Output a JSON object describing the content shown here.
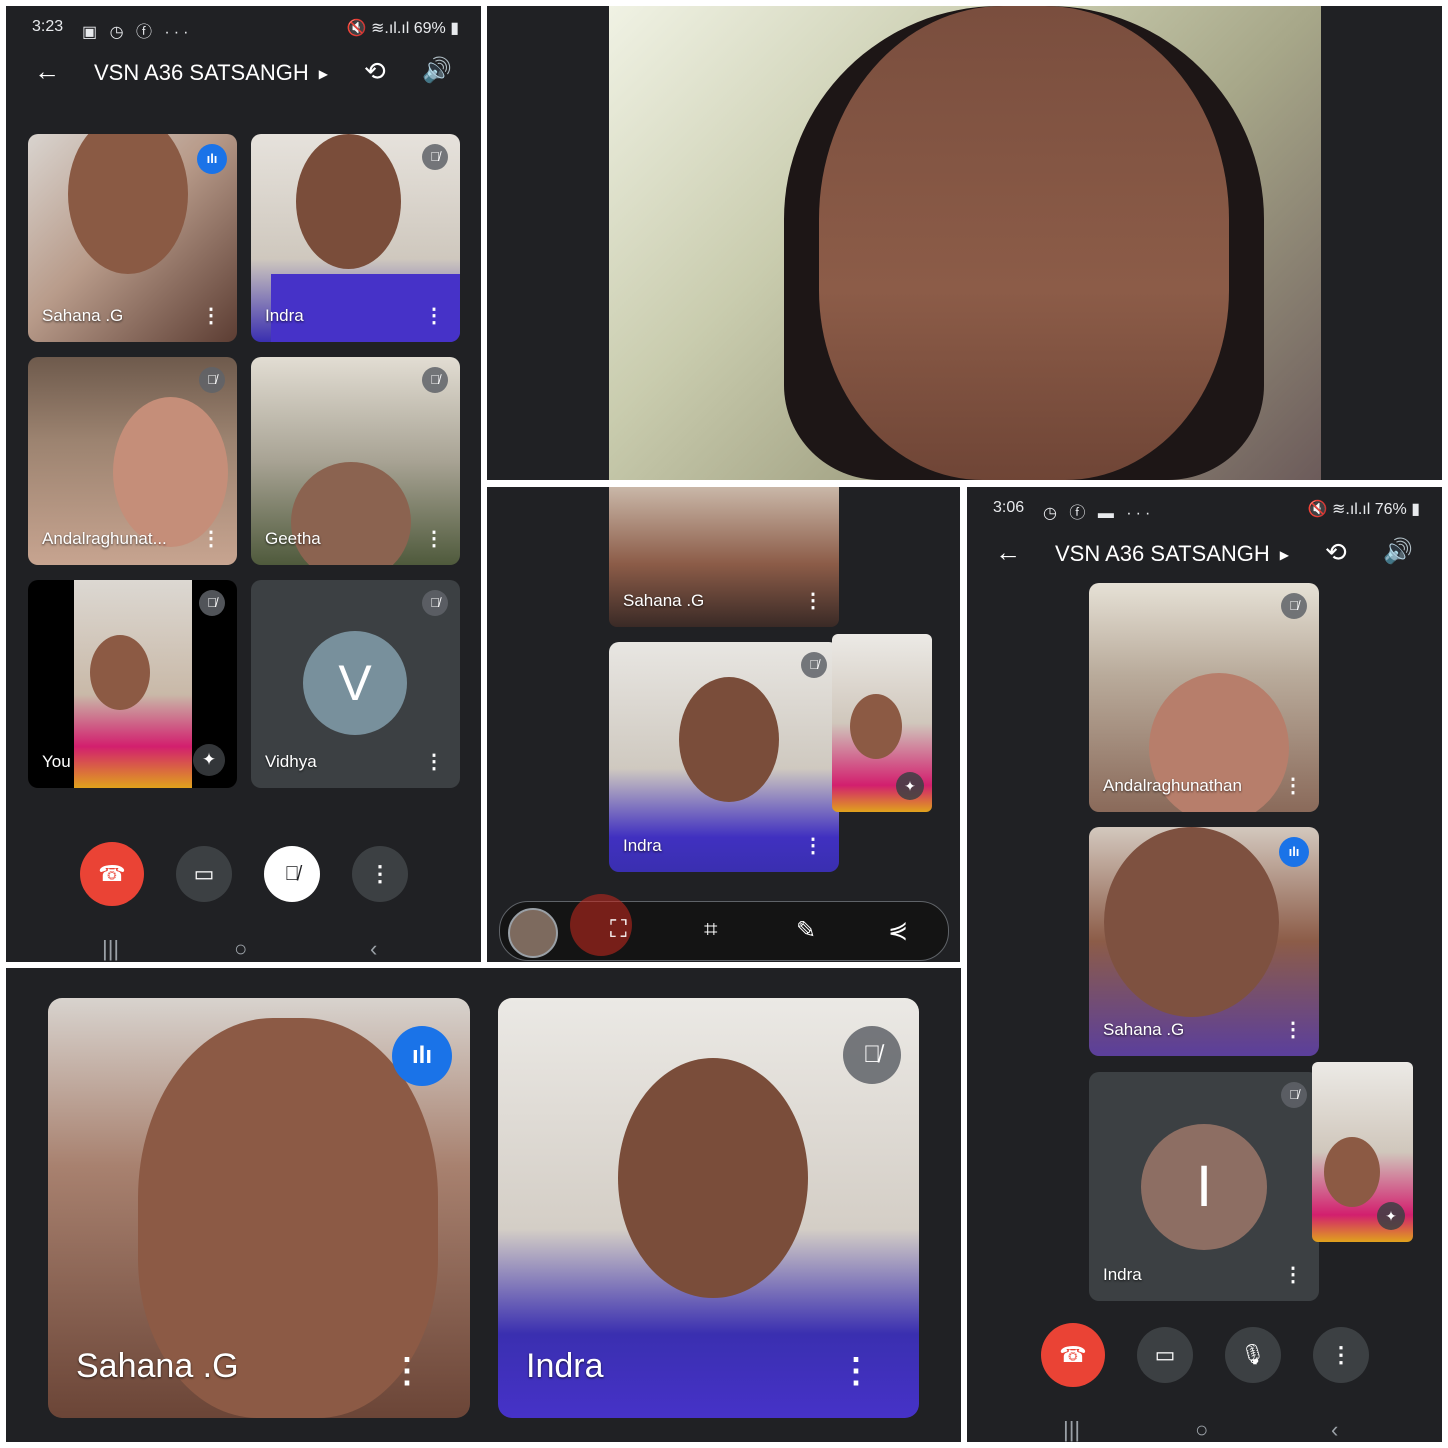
{
  "meeting_title": "VSN A36 SATSANGH",
  "colors": {
    "accent": "#1a73e8",
    "end_call": "#ea4335",
    "background": "#202124",
    "tile": "#3c4043"
  },
  "icons": {
    "back": "back-arrow-icon",
    "camera_switch": "camera-switch-icon",
    "speaker": "speaker-icon",
    "more": "more-vertical-icon",
    "mic_off": "mic-off-icon",
    "audio_level": "audio-level-icon",
    "effects": "sparkle-icon"
  },
  "panel1": {
    "status": {
      "time": "3:23",
      "icons": "▣ ◷ ⓕ ···",
      "right": "🔇 ≋.ıl.ıl 69% ▮"
    },
    "tiles": [
      {
        "name": "Sahana .G"
      },
      {
        "name": "Indra"
      },
      {
        "name": "Andalraghunat..."
      },
      {
        "name": "Geetha"
      },
      {
        "name": "You"
      },
      {
        "name": "Vidhya",
        "initial": "V"
      }
    ]
  },
  "panel3": {
    "tiles": [
      {
        "name": "Sahana .G"
      },
      {
        "name": "Indra"
      }
    ]
  },
  "panel4": {
    "status": {
      "time": "3:06",
      "icons": "◷ ⓕ ▬ ···",
      "right": "🔇 ≋.ıl.ıl 76% ▮"
    },
    "tiles": [
      {
        "name": "Andalraghunathan"
      },
      {
        "name": "Sahana .G"
      },
      {
        "name": "Indra",
        "initial": "I"
      }
    ]
  },
  "panel5": {
    "tiles": [
      {
        "name": "Sahana .G"
      },
      {
        "name": "Indra"
      }
    ]
  },
  "nav": {
    "recents": "|||",
    "home": "○",
    "back": "‹"
  }
}
